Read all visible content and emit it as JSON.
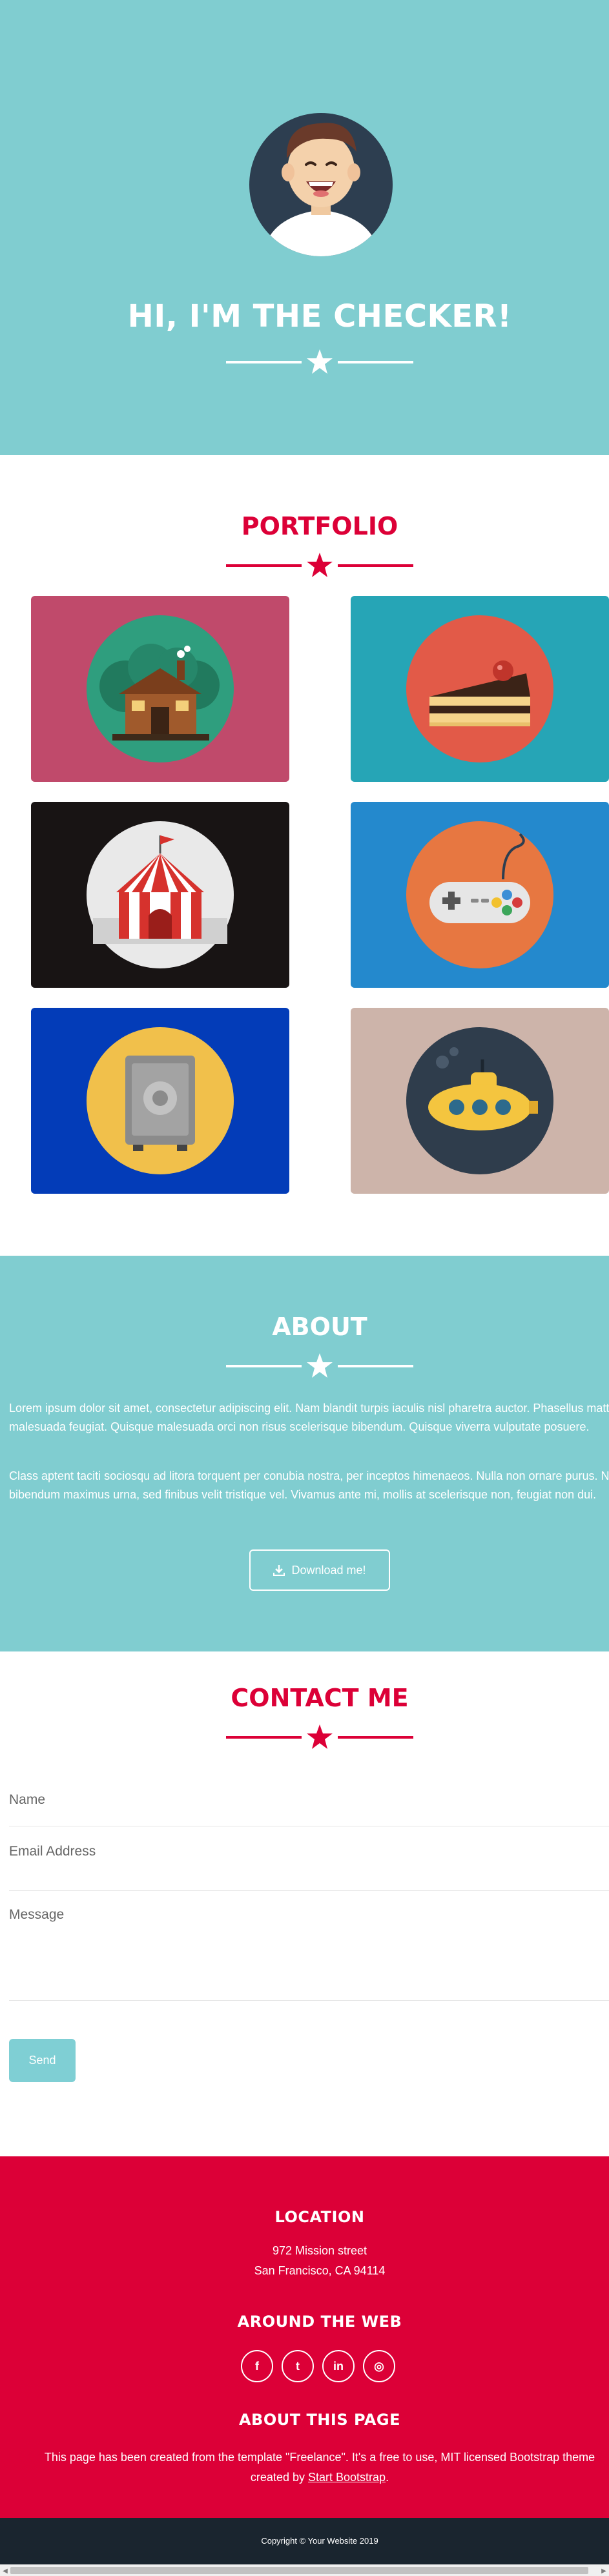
{
  "colors": {
    "teal": "#80cdd0",
    "crimson": "#dc0037",
    "footer_dark": "#1a252f"
  },
  "hero": {
    "title": "HI, I'M THE CHECKER!",
    "avatar": "avatar"
  },
  "portfolio": {
    "title": "PORTFOLIO",
    "items": [
      {
        "icon": "cabin-icon",
        "color": "#c04a6b"
      },
      {
        "icon": "cake-icon",
        "color": "#26a5b6"
      },
      {
        "icon": "circus-tent-icon",
        "color": "#181414"
      },
      {
        "icon": "game-controller-icon",
        "color": "#2489cd"
      },
      {
        "icon": "safe-icon",
        "color": "#033cb8"
      },
      {
        "icon": "submarine-icon",
        "color": "#cdb4aa"
      }
    ]
  },
  "about": {
    "title": "ABOUT",
    "p1": "Lorem ipsum dolor sit amet, consectetur adipiscing elit. Nam blandit turpis iaculis nisl pharetra auctor. Phasellus mattis malesuada feugiat. Quisque malesuada orci non risus scelerisque bibendum. Quisque viverra vulputate posuere.",
    "p2": "Class aptent taciti sociosqu ad litora torquent per conubia nostra, per inceptos himenaeos. Nulla non ornare purus. Nulla bibendum maximus urna, sed finibus velit tristique vel. Vivamus ante mi, mollis at scelerisque non, feugiat non dui.",
    "download_label": "Download me!"
  },
  "contact": {
    "title": "CONTACT ME",
    "name_placeholder": "Name",
    "email_placeholder": "Email Address",
    "message_placeholder": "Message",
    "send_label": "Send"
  },
  "footer": {
    "location_title": "LOCATION",
    "address_line1": "972 Mission street",
    "address_line2": "San Francisco, CA 94114",
    "web_title": "AROUND THE WEB",
    "social": [
      {
        "icon": "facebook-icon",
        "glyph": "f"
      },
      {
        "icon": "twitter-icon",
        "glyph": "t"
      },
      {
        "icon": "linkedin-icon",
        "glyph": "in"
      },
      {
        "icon": "dribbble-icon",
        "glyph": "◎"
      }
    ],
    "about_title": "ABOUT THIS PAGE",
    "about_text": "This page has been created from the template \"Freelance\". It's a free to use, MIT licensed Bootstrap theme",
    "created_by": "created by",
    "link_text": "Start Bootstrap",
    "link_suffix": ".",
    "copyright": "Copyright © Your Website 2019"
  }
}
